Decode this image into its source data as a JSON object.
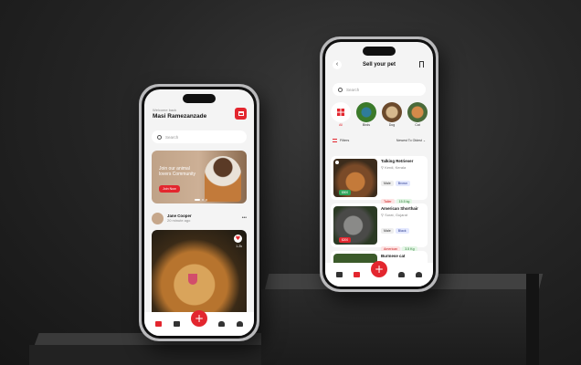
{
  "phone1": {
    "welcome": "Welcome back",
    "user_name": "Masi Ramezanzade",
    "search_placeholder": "Search",
    "banner_text": "Join our animal lovers Community",
    "banner_button": "Join Now",
    "post_author": "Jane Cooper",
    "post_time": "20 minute ago",
    "post_likes": "1.2k",
    "post_menu": "•••"
  },
  "phone2": {
    "title": "Sell your pet",
    "back_icon": "‹",
    "search_placeholder": "Search",
    "categories": [
      {
        "label": "All"
      },
      {
        "label": "Birds"
      },
      {
        "label": "Dog"
      },
      {
        "label": "Cat"
      }
    ],
    "filters_label": "Filters",
    "sort_label": "Newest To Oldest",
    "listings": [
      {
        "name": "Talking Retriever",
        "location": "Kerdi, Kerala",
        "gender": "Male",
        "color": "Brown",
        "age": "Tailer",
        "weight": "15.5 kg",
        "price": "$500"
      },
      {
        "name": "American Shorthair",
        "location": "Surat, Gujarat",
        "gender": "Male",
        "color": "Black",
        "age": "American",
        "weight": "3.5 Kg",
        "price": "$200"
      },
      {
        "name": "Burmese cat",
        "location": "",
        "gender": "",
        "color": "",
        "age": "",
        "weight": "",
        "price": ""
      }
    ]
  },
  "nav": {
    "fab": "+"
  },
  "colors": {
    "accent": "#e3262e",
    "background": "#262626"
  }
}
